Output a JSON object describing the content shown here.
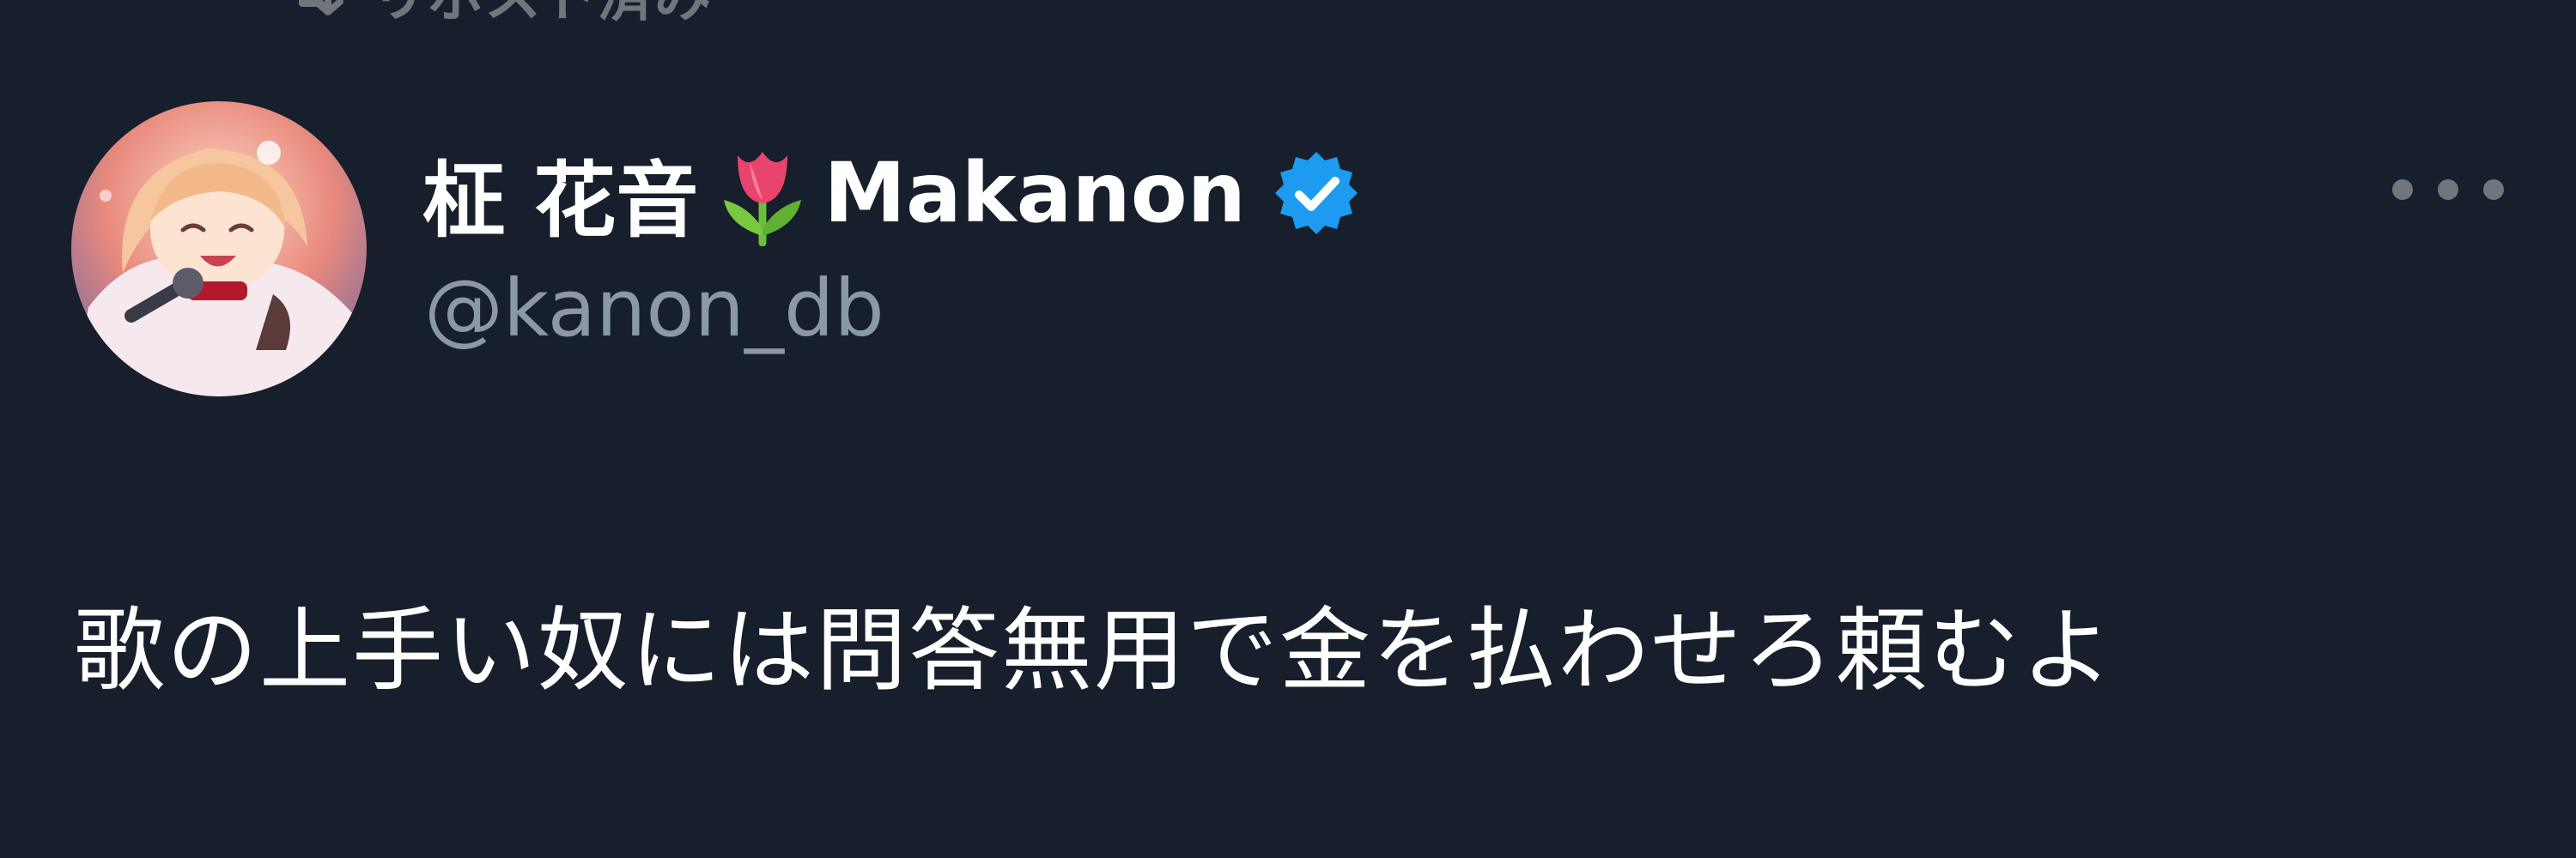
{
  "repost": {
    "icon": "repost-icon",
    "label": "リポスト済み"
  },
  "author": {
    "avatar": "avatar",
    "display_name": "柾 花音",
    "emoji": "tulip-icon",
    "latin_name": "Makanon",
    "verified": "verified-badge-icon",
    "handle": "@kanon_db"
  },
  "menu": {
    "icon": "more-options-icon"
  },
  "tweet": {
    "text": "歌の上手い奴には問答無用で金を払わせろ頼むよ"
  },
  "colors": {
    "background": "#161f2b",
    "primary_text": "#ffffff",
    "secondary_text": "#8b98a5",
    "verified_badge": "#1d9bf0"
  }
}
